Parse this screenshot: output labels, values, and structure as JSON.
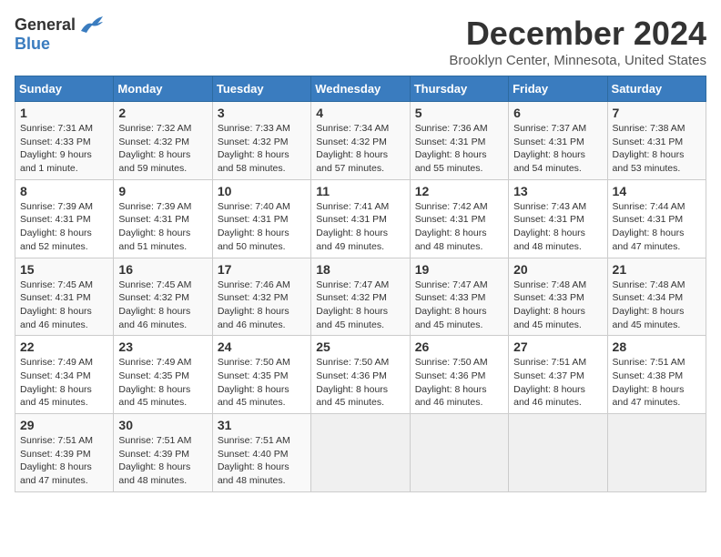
{
  "logo": {
    "general": "General",
    "blue": "Blue"
  },
  "title": "December 2024",
  "location": "Brooklyn Center, Minnesota, United States",
  "days_of_week": [
    "Sunday",
    "Monday",
    "Tuesday",
    "Wednesday",
    "Thursday",
    "Friday",
    "Saturday"
  ],
  "weeks": [
    [
      {
        "day": "1",
        "sunrise": "Sunrise: 7:31 AM",
        "sunset": "Sunset: 4:33 PM",
        "daylight": "Daylight: 9 hours and 1 minute."
      },
      {
        "day": "2",
        "sunrise": "Sunrise: 7:32 AM",
        "sunset": "Sunset: 4:32 PM",
        "daylight": "Daylight: 8 hours and 59 minutes."
      },
      {
        "day": "3",
        "sunrise": "Sunrise: 7:33 AM",
        "sunset": "Sunset: 4:32 PM",
        "daylight": "Daylight: 8 hours and 58 minutes."
      },
      {
        "day": "4",
        "sunrise": "Sunrise: 7:34 AM",
        "sunset": "Sunset: 4:32 PM",
        "daylight": "Daylight: 8 hours and 57 minutes."
      },
      {
        "day": "5",
        "sunrise": "Sunrise: 7:36 AM",
        "sunset": "Sunset: 4:31 PM",
        "daylight": "Daylight: 8 hours and 55 minutes."
      },
      {
        "day": "6",
        "sunrise": "Sunrise: 7:37 AM",
        "sunset": "Sunset: 4:31 PM",
        "daylight": "Daylight: 8 hours and 54 minutes."
      },
      {
        "day": "7",
        "sunrise": "Sunrise: 7:38 AM",
        "sunset": "Sunset: 4:31 PM",
        "daylight": "Daylight: 8 hours and 53 minutes."
      }
    ],
    [
      {
        "day": "8",
        "sunrise": "Sunrise: 7:39 AM",
        "sunset": "Sunset: 4:31 PM",
        "daylight": "Daylight: 8 hours and 52 minutes."
      },
      {
        "day": "9",
        "sunrise": "Sunrise: 7:39 AM",
        "sunset": "Sunset: 4:31 PM",
        "daylight": "Daylight: 8 hours and 51 minutes."
      },
      {
        "day": "10",
        "sunrise": "Sunrise: 7:40 AM",
        "sunset": "Sunset: 4:31 PM",
        "daylight": "Daylight: 8 hours and 50 minutes."
      },
      {
        "day": "11",
        "sunrise": "Sunrise: 7:41 AM",
        "sunset": "Sunset: 4:31 PM",
        "daylight": "Daylight: 8 hours and 49 minutes."
      },
      {
        "day": "12",
        "sunrise": "Sunrise: 7:42 AM",
        "sunset": "Sunset: 4:31 PM",
        "daylight": "Daylight: 8 hours and 48 minutes."
      },
      {
        "day": "13",
        "sunrise": "Sunrise: 7:43 AM",
        "sunset": "Sunset: 4:31 PM",
        "daylight": "Daylight: 8 hours and 48 minutes."
      },
      {
        "day": "14",
        "sunrise": "Sunrise: 7:44 AM",
        "sunset": "Sunset: 4:31 PM",
        "daylight": "Daylight: 8 hours and 47 minutes."
      }
    ],
    [
      {
        "day": "15",
        "sunrise": "Sunrise: 7:45 AM",
        "sunset": "Sunset: 4:31 PM",
        "daylight": "Daylight: 8 hours and 46 minutes."
      },
      {
        "day": "16",
        "sunrise": "Sunrise: 7:45 AM",
        "sunset": "Sunset: 4:32 PM",
        "daylight": "Daylight: 8 hours and 46 minutes."
      },
      {
        "day": "17",
        "sunrise": "Sunrise: 7:46 AM",
        "sunset": "Sunset: 4:32 PM",
        "daylight": "Daylight: 8 hours and 46 minutes."
      },
      {
        "day": "18",
        "sunrise": "Sunrise: 7:47 AM",
        "sunset": "Sunset: 4:32 PM",
        "daylight": "Daylight: 8 hours and 45 minutes."
      },
      {
        "day": "19",
        "sunrise": "Sunrise: 7:47 AM",
        "sunset": "Sunset: 4:33 PM",
        "daylight": "Daylight: 8 hours and 45 minutes."
      },
      {
        "day": "20",
        "sunrise": "Sunrise: 7:48 AM",
        "sunset": "Sunset: 4:33 PM",
        "daylight": "Daylight: 8 hours and 45 minutes."
      },
      {
        "day": "21",
        "sunrise": "Sunrise: 7:48 AM",
        "sunset": "Sunset: 4:34 PM",
        "daylight": "Daylight: 8 hours and 45 minutes."
      }
    ],
    [
      {
        "day": "22",
        "sunrise": "Sunrise: 7:49 AM",
        "sunset": "Sunset: 4:34 PM",
        "daylight": "Daylight: 8 hours and 45 minutes."
      },
      {
        "day": "23",
        "sunrise": "Sunrise: 7:49 AM",
        "sunset": "Sunset: 4:35 PM",
        "daylight": "Daylight: 8 hours and 45 minutes."
      },
      {
        "day": "24",
        "sunrise": "Sunrise: 7:50 AM",
        "sunset": "Sunset: 4:35 PM",
        "daylight": "Daylight: 8 hours and 45 minutes."
      },
      {
        "day": "25",
        "sunrise": "Sunrise: 7:50 AM",
        "sunset": "Sunset: 4:36 PM",
        "daylight": "Daylight: 8 hours and 45 minutes."
      },
      {
        "day": "26",
        "sunrise": "Sunrise: 7:50 AM",
        "sunset": "Sunset: 4:36 PM",
        "daylight": "Daylight: 8 hours and 46 minutes."
      },
      {
        "day": "27",
        "sunrise": "Sunrise: 7:51 AM",
        "sunset": "Sunset: 4:37 PM",
        "daylight": "Daylight: 8 hours and 46 minutes."
      },
      {
        "day": "28",
        "sunrise": "Sunrise: 7:51 AM",
        "sunset": "Sunset: 4:38 PM",
        "daylight": "Daylight: 8 hours and 47 minutes."
      }
    ],
    [
      {
        "day": "29",
        "sunrise": "Sunrise: 7:51 AM",
        "sunset": "Sunset: 4:39 PM",
        "daylight": "Daylight: 8 hours and 47 minutes."
      },
      {
        "day": "30",
        "sunrise": "Sunrise: 7:51 AM",
        "sunset": "Sunset: 4:39 PM",
        "daylight": "Daylight: 8 hours and 48 minutes."
      },
      {
        "day": "31",
        "sunrise": "Sunrise: 7:51 AM",
        "sunset": "Sunset: 4:40 PM",
        "daylight": "Daylight: 8 hours and 48 minutes."
      },
      null,
      null,
      null,
      null
    ]
  ]
}
